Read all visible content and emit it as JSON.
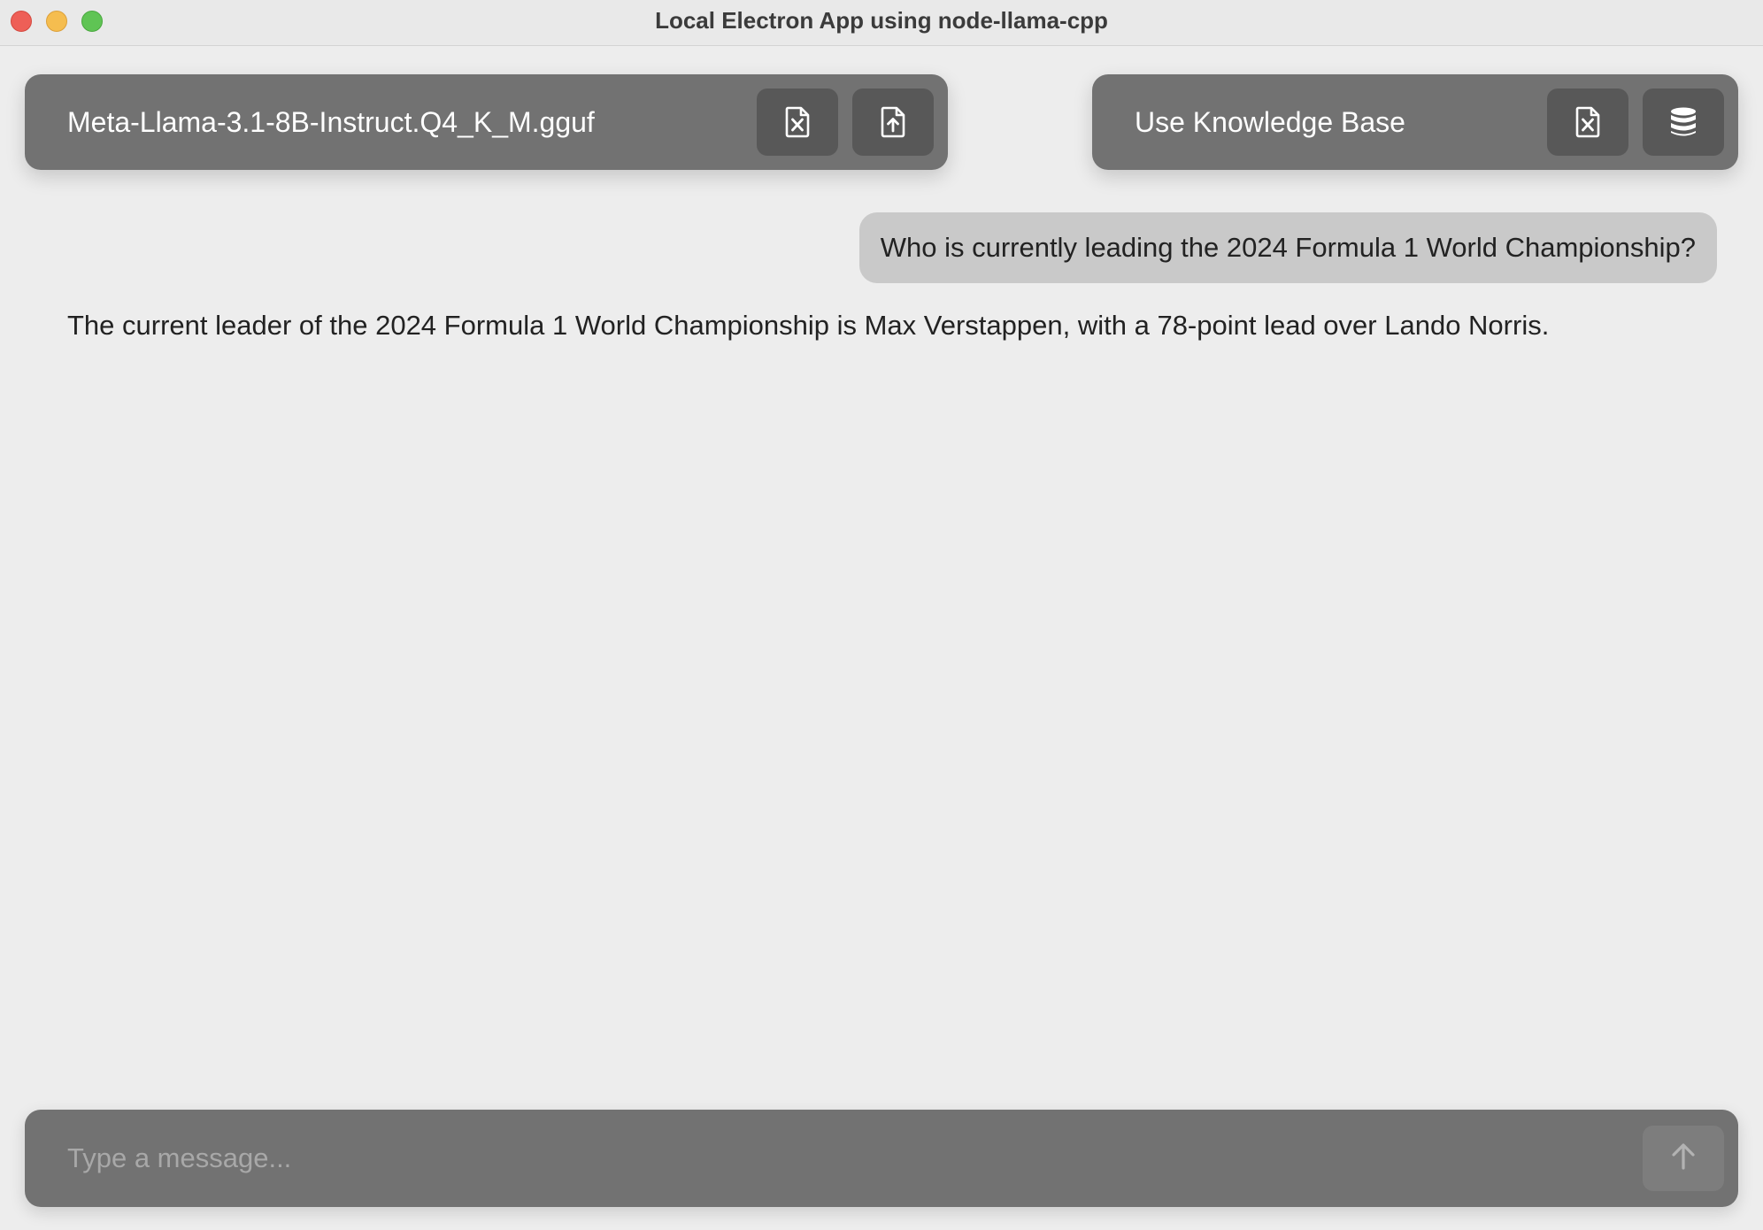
{
  "window": {
    "title": "Local Electron App using node-llama-cpp"
  },
  "model_panel": {
    "model_name": "Meta-Llama-3.1-8B-Instruct.Q4_K_M.gguf",
    "delete_icon": "file-x-icon",
    "upload_icon": "file-upload-icon"
  },
  "knowledge_panel": {
    "label": "Use Knowledge Base",
    "delete_icon": "file-x-icon",
    "database_icon": "database-icon"
  },
  "messages": [
    {
      "role": "user",
      "text": "Who is currently leading the 2024 Formula 1 World Championship?"
    },
    {
      "role": "assistant",
      "text": "The current leader of the 2024 Formula 1 World Championship is Max Verstappen, with a 78-point lead over Lando Norris."
    }
  ],
  "composer": {
    "placeholder": "Type a message...",
    "value": "",
    "send_icon": "arrow-up-icon"
  },
  "colors": {
    "background": "#ededed",
    "panel": "#727272",
    "button": "#585858",
    "user_bubble": "#c9c9c9"
  }
}
